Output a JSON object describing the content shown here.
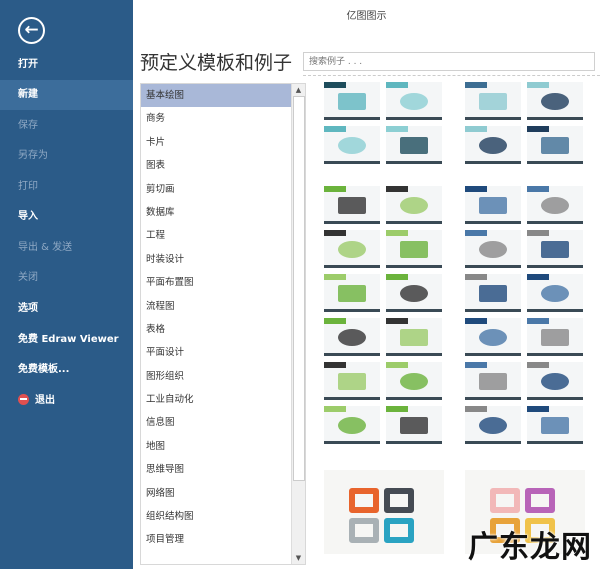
{
  "app_title": "亿图图示",
  "sidebar": {
    "items": [
      {
        "label": "打开",
        "state": "normal"
      },
      {
        "label": "新建",
        "state": "selected"
      },
      {
        "label": "保存",
        "state": "disabled"
      },
      {
        "label": "另存为",
        "state": "disabled"
      },
      {
        "label": "打印",
        "state": "disabled"
      },
      {
        "label": "导入",
        "state": "normal"
      },
      {
        "label": "导出 & 发送",
        "state": "disabled"
      },
      {
        "label": "关闭",
        "state": "disabled"
      },
      {
        "label": "选项",
        "state": "normal"
      },
      {
        "label": "免费 Edraw Viewer",
        "state": "normal"
      },
      {
        "label": "免费模板...",
        "state": "normal"
      },
      {
        "label": "退出",
        "state": "normal",
        "icon": "exit-icon"
      }
    ]
  },
  "main": {
    "heading": "预定义模板和例子",
    "search_placeholder": "搜索例子 . . ."
  },
  "categories": [
    "基本绘图",
    "商务",
    "卡片",
    "图表",
    "剪切画",
    "数据库",
    "工程",
    "时装设计",
    "平面布置图",
    "流程图",
    "表格",
    "平面设计",
    "图形组织",
    "工业自动化",
    "信息图",
    "地图",
    "思维导图",
    "网络图",
    "组织结构图",
    "项目管理"
  ],
  "selected_category": "基本绘图",
  "watermark": "广东龙网",
  "colors": {
    "sidebar": "#2b5b88",
    "selected": "#a9b8d8",
    "teal": "#1e4d5c",
    "green": "#6bb33c",
    "navy": "#1f4a7c"
  }
}
